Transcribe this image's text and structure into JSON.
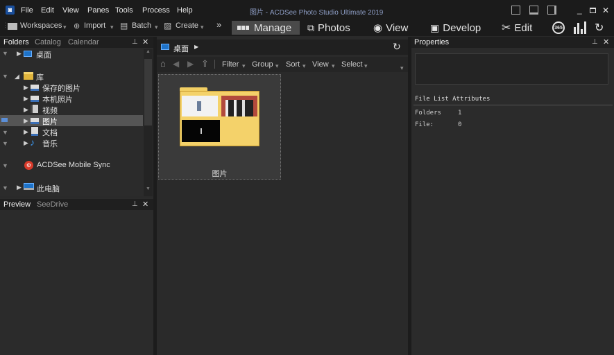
{
  "window": {
    "title": "图片 - ACDSee Photo Studio Ultimate 2019"
  },
  "menu": [
    "File",
    "Edit",
    "View",
    "Panes",
    "Tools",
    "Process",
    "Help"
  ],
  "toolbar": {
    "workspaces": "Workspaces",
    "import": "Import",
    "batch": "Batch",
    "create": "Create",
    "overflow": "»"
  },
  "modes": [
    {
      "label": "Manage"
    },
    {
      "label": "Photos"
    },
    {
      "label": "View"
    },
    {
      "label": "Develop"
    },
    {
      "label": "Edit"
    },
    {
      "label": "365"
    }
  ],
  "left_pane": {
    "tabs": [
      "Folders",
      "Catalog",
      "Calendar"
    ],
    "tree": [
      {
        "label": "桌面"
      },
      {
        "label": "库"
      },
      {
        "label": "保存的图片"
      },
      {
        "label": "本机照片"
      },
      {
        "label": "视频"
      },
      {
        "label": "图片"
      },
      {
        "label": "文档"
      },
      {
        "label": "音乐"
      },
      {
        "label": "ACDSee Mobile Sync"
      },
      {
        "label": "此电脑"
      }
    ],
    "bottom_tabs": [
      "Preview",
      "SeeDrive"
    ]
  },
  "center": {
    "breadcrumb": "桌面",
    "filters": [
      "Filter",
      "Group",
      "Sort",
      "View",
      "Select"
    ],
    "item": {
      "label": "图片"
    }
  },
  "right_pane": {
    "title": "Properties",
    "section": "File List Attributes",
    "rows": [
      {
        "key": "Folders",
        "value": "1"
      },
      {
        "key": "File:",
        "value": "0"
      }
    ]
  }
}
